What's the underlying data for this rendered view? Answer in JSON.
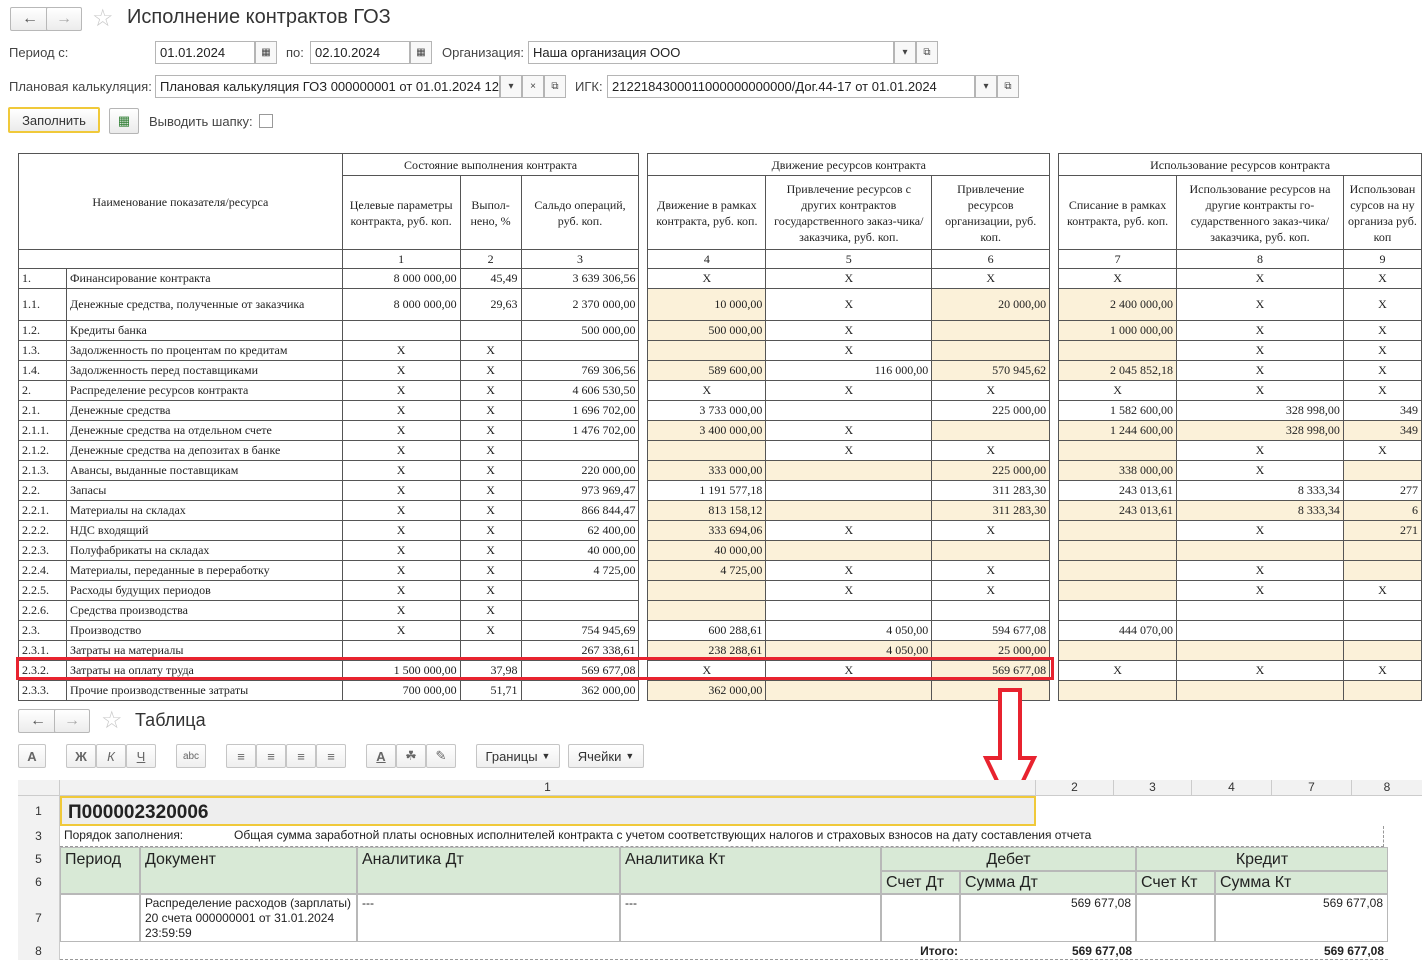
{
  "window": {
    "title": "Исполнение контрактов ГОЗ"
  },
  "filters": {
    "period_from_label": "Период с:",
    "period_from": "01.01.2024",
    "period_to_label": "по:",
    "period_to": "02.10.2024",
    "org_label": "Организация:",
    "org": "Наша организация ООО",
    "plan_label": "Плановая калькуляция:",
    "plan": "Плановая калькуляция ГОЗ 000000001 от 01.01.2024 12:",
    "igk_label": "ИГК:",
    "igk": "2122184300011000000000000/Дог.44-17 от 01.01.2024",
    "fill_button": "Заполнить",
    "show_header_label": "Выводить шапку:"
  },
  "report": {
    "col_name": "Наименование показателя/ресурса",
    "group1": "Состояние выполнения контракта",
    "group2": "Движение ресурсов контракта",
    "group3": "Использование ресурсов контракта",
    "h1": "Целевые параметры контракта, руб. коп.",
    "h2": "Выпол-нено, %",
    "h3": "Сальдо операций, руб. коп.",
    "h4": "Движение в рамках контракта, руб. коп.",
    "h5": "Привлечение ресурсов с других контрактов государственного заказ-чика/заказчика, руб. коп.",
    "h6": "Привлечение ресурсов организации, руб. коп.",
    "h7": "Списание в рамках контракта, руб. коп.",
    "h8": "Использование ресурсов на другие контракты го-сударственного заказ-чика/заказчика, руб. коп.",
    "h9": "Использован сурсов на ну организа руб. коп",
    "nums": [
      "1",
      "2",
      "3",
      "4",
      "5",
      "6",
      "7",
      "8",
      "9"
    ],
    "rows": [
      {
        "no": "1.",
        "name": "Финансирование контракта",
        "c1": "8 000 000,00",
        "c2": "45,49",
        "c3": "3 639 306,56",
        "c4": "X",
        "c5": "X",
        "c6": "X",
        "c7": "X",
        "c8": "X",
        "c9": "X",
        "y": []
      },
      {
        "no": "1.1.",
        "name": "Денежные средства, полученные от заказчика",
        "c1": "8 000 000,00",
        "c2": "29,63",
        "c3": "2 370 000,00",
        "c4": "10 000,00",
        "c5": "X",
        "c6": "20 000,00",
        "c7": "2 400 000,00",
        "c8": "X",
        "c9": "X",
        "y": [
          4,
          6,
          7
        ]
      },
      {
        "no": "1.2.",
        "name": "Кредиты банка",
        "c1": "",
        "c2": "",
        "c3": "500 000,00",
        "c4": "500 000,00",
        "c5": "X",
        "c6": "",
        "c7": "1 000 000,00",
        "c8": "X",
        "c9": "X",
        "y": [
          4,
          6,
          7
        ]
      },
      {
        "no": "1.3.",
        "name": "Задолженность по процентам по кредитам",
        "c1": "X",
        "c2": "X",
        "c3": "",
        "c4": "",
        "c5": "X",
        "c6": "",
        "c7": "",
        "c8": "X",
        "c9": "X",
        "y": [
          4,
          6,
          7
        ]
      },
      {
        "no": "1.4.",
        "name": "Задолженность перед поставщиками",
        "c1": "X",
        "c2": "X",
        "c3": "769 306,56",
        "c4": "589 600,00",
        "c5": "116 000,00",
        "c6": "570 945,62",
        "c7": "2 045 852,18",
        "c8": "X",
        "c9": "X",
        "y": [
          4,
          6,
          7
        ]
      },
      {
        "no": "2.",
        "name": "Распределение ресурсов контракта",
        "c1": "X",
        "c2": "X",
        "c3": "4 606 530,50",
        "c4": "X",
        "c5": "X",
        "c6": "X",
        "c7": "X",
        "c8": "X",
        "c9": "X",
        "y": []
      },
      {
        "no": "2.1.",
        "name": "Денежные средства",
        "c1": "X",
        "c2": "X",
        "c3": "1 696 702,00",
        "c4": "3 733 000,00",
        "c5": "",
        "c6": "225 000,00",
        "c7": "1 582 600,00",
        "c8": "328 998,00",
        "c9": "349",
        "y": []
      },
      {
        "no": "2.1.1.",
        "name": "Денежные средства на отдельном счете",
        "c1": "X",
        "c2": "X",
        "c3": "1 476 702,00",
        "c4": "3 400 000,00",
        "c5": "X",
        "c6": "",
        "c7": "1 244 600,00",
        "c8": "328 998,00",
        "c9": "349",
        "y": [
          4,
          6,
          7,
          8,
          9
        ]
      },
      {
        "no": "2.1.2.",
        "name": "Денежные средства на депозитах в банке",
        "c1": "X",
        "c2": "X",
        "c3": "",
        "c4": "",
        "c5": "X",
        "c6": "X",
        "c7": "",
        "c8": "X",
        "c9": "X",
        "y": [
          4,
          7
        ]
      },
      {
        "no": "2.1.3.",
        "name": "Авансы, выданные поставщикам",
        "c1": "X",
        "c2": "X",
        "c3": "220 000,00",
        "c4": "333 000,00",
        "c5": "",
        "c6": "225 000,00",
        "c7": "338 000,00",
        "c8": "X",
        "c9": "",
        "y": [
          4,
          5,
          6,
          7,
          9
        ]
      },
      {
        "no": "2.2.",
        "name": "Запасы",
        "c1": "X",
        "c2": "X",
        "c3": "973 969,47",
        "c4": "1 191 577,18",
        "c5": "",
        "c6": "311 283,30",
        "c7": "243 013,61",
        "c8": "8 333,34",
        "c9": "277",
        "y": []
      },
      {
        "no": "2.2.1.",
        "name": "Материалы на складах",
        "c1": "X",
        "c2": "X",
        "c3": "866 844,47",
        "c4": "813 158,12",
        "c5": "",
        "c6": "311 283,30",
        "c7": "243 013,61",
        "c8": "8 333,34",
        "c9": "6",
        "y": [
          4,
          5,
          6,
          7,
          8,
          9
        ]
      },
      {
        "no": "2.2.2.",
        "name": "НДС входящий",
        "c1": "X",
        "c2": "X",
        "c3": "62 400,00",
        "c4": "333 694,06",
        "c5": "X",
        "c6": "X",
        "c7": "",
        "c8": "X",
        "c9": "271",
        "y": [
          4,
          7,
          9
        ]
      },
      {
        "no": "2.2.3.",
        "name": "Полуфабрикаты на складах",
        "c1": "X",
        "c2": "X",
        "c3": "40 000,00",
        "c4": "40 000,00",
        "c5": "",
        "c6": "",
        "c7": "",
        "c8": "",
        "c9": "",
        "y": [
          4,
          5,
          6,
          7,
          8,
          9
        ]
      },
      {
        "no": "2.2.4.",
        "name": "Материалы, переданные в переработку",
        "c1": "X",
        "c2": "X",
        "c3": "4 725,00",
        "c4": "4 725,00",
        "c5": "X",
        "c6": "X",
        "c7": "",
        "c8": "X",
        "c9": "",
        "y": [
          4,
          7,
          9
        ]
      },
      {
        "no": "2.2.5.",
        "name": "Расходы будущих периодов",
        "c1": "X",
        "c2": "X",
        "c3": "",
        "c4": "",
        "c5": "X",
        "c6": "X",
        "c7": "",
        "c8": "X",
        "c9": "X",
        "y": [
          4,
          7
        ]
      },
      {
        "no": "2.2.6.",
        "name": "Средства производства",
        "c1": "X",
        "c2": "X",
        "c3": "",
        "c4": "",
        "c5": "",
        "c6": "",
        "c7": "",
        "c8": "",
        "c9": "",
        "y": [
          4
        ]
      },
      {
        "no": "2.3.",
        "name": "Производство",
        "c1": "X",
        "c2": "X",
        "c3": "754 945,69",
        "c4": "600 288,61",
        "c5": "4 050,00",
        "c6": "594 677,08",
        "c7": "444 070,00",
        "c8": "",
        "c9": "",
        "y": []
      },
      {
        "no": "2.3.1.",
        "name": "Затраты на материалы",
        "c1": "",
        "c2": "",
        "c3": "267 338,61",
        "c4": "238 288,61",
        "c5": "4 050,00",
        "c6": "25 000,00",
        "c7": "",
        "c8": "",
        "c9": "",
        "y": [
          4,
          5,
          6,
          7,
          8,
          9
        ]
      },
      {
        "no": "2.3.2.",
        "name": "Затраты на оплату труда",
        "c1": "1 500 000,00",
        "c2": "37,98",
        "c3": "569 677,08",
        "c4": "X",
        "c5": "X",
        "c6": "569 677,08",
        "c7": "X",
        "c8": "X",
        "c9": "X",
        "y": [
          6
        ]
      },
      {
        "no": "2.3.3.",
        "name": "Прочие производственные затраты",
        "c1": "700 000,00",
        "c2": "51,71",
        "c3": "362 000,00",
        "c4": "362 000,00",
        "c5": "",
        "c6": "",
        "c7": "",
        "c8": "",
        "c9": "",
        "y": [
          4,
          5,
          6,
          7,
          8,
          9
        ]
      }
    ]
  },
  "table_window": {
    "title": "Таблица",
    "borders": "Границы",
    "cells": "Ячейки",
    "tb_bold": "Ж",
    "tb_italic": "К",
    "tb_underline": "Ч",
    "tb_font": "A",
    "tb_spell": "аbс"
  },
  "sheet": {
    "col_numbers": [
      "1",
      "2",
      "3",
      "4",
      "7",
      "8"
    ],
    "row_numbers": [
      "1",
      "3",
      "5",
      "6",
      "7",
      "8"
    ],
    "code": "П000002320006",
    "order_label": "Порядок заполнения:",
    "order_text": "Общая сумма заработной платы основных исполнителей контракта с учетом соответствующих налогов и страховых взносов на дату составления отчета",
    "h_period": "Период",
    "h_document": "Документ",
    "h_an_dt": "Аналитика Дт",
    "h_an_kt": "Аналитика Кт",
    "h_debit": "Дебет",
    "h_credit": "Кредит",
    "h_acc_dt": "Счет Дт",
    "h_sum_dt": "Сумма Дт",
    "h_acc_kt": "Счет Кт",
    "h_sum_kt": "Сумма Кт",
    "r_document": "Распределение расходов (зарплаты) 20 счета 000000001 от 31.01.2024 23:59:59",
    "r_an_dt": "---",
    "r_an_kt": "---",
    "r_sum_dt": "569 677,08",
    "r_sum_kt": "569 677,08",
    "total_label": "Итого:",
    "total_dt": "569 677,08",
    "total_kt": "569 677,08"
  },
  "colors": {
    "highlight": "#e8232f",
    "yellow_cell": "#fbf1d9",
    "green_header": "#d8e9d6",
    "focus_border": "#f0c93a"
  }
}
